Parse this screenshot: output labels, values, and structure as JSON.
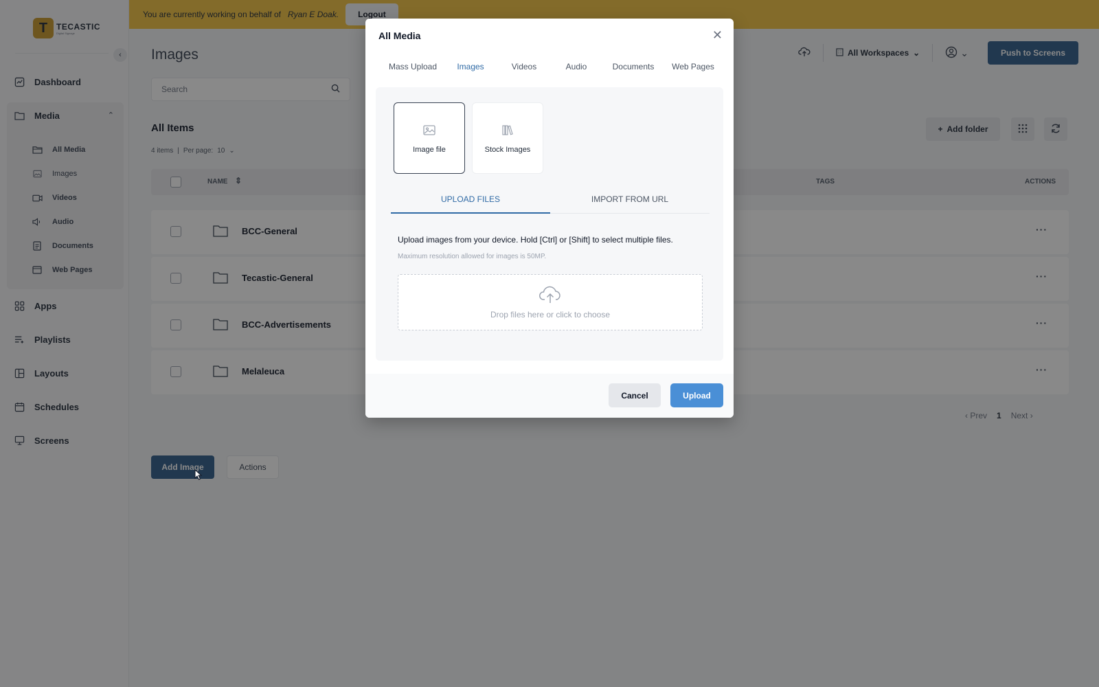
{
  "banner": {
    "prefix": "You are currently working on behalf of",
    "user": "Ryan E Doak.",
    "logout_label": "Logout"
  },
  "brand": {
    "name": "TECASTIC",
    "tagline": "Digital Signage",
    "color": "#c9982a"
  },
  "sidebar": {
    "items": [
      {
        "label": "Dashboard",
        "icon": "dashboard-icon"
      },
      {
        "label": "Media",
        "icon": "folder-icon"
      },
      {
        "label": "Apps",
        "icon": "apps-grid-icon"
      },
      {
        "label": "Playlists",
        "icon": "playlist-icon"
      },
      {
        "label": "Layouts",
        "icon": "layout-icon"
      },
      {
        "label": "Schedules",
        "icon": "calendar-icon"
      },
      {
        "label": "Screens",
        "icon": "monitor-icon"
      }
    ],
    "media_items": [
      {
        "label": "All Media",
        "icon": "folder-open-icon"
      },
      {
        "label": "Images",
        "icon": "image-icon"
      },
      {
        "label": "Videos",
        "icon": "video-icon"
      },
      {
        "label": "Audio",
        "icon": "speaker-icon"
      },
      {
        "label": "Documents",
        "icon": "document-icon"
      },
      {
        "label": "Web Pages",
        "icon": "browser-icon"
      }
    ]
  },
  "header": {
    "title": "Images",
    "search_placeholder": "Search",
    "workspace": "All Workspaces",
    "push_label": "Push to Screens"
  },
  "list": {
    "title": "All Items",
    "count": "4 items",
    "per_page_label": "Per page:",
    "per_page_value": "10",
    "add_folder_label": "Add folder",
    "columns": {
      "name": "NAME",
      "tags": "TAGS",
      "actions": "ACTIONS"
    },
    "rows": [
      {
        "name": "BCC-General"
      },
      {
        "name": "Tecastic-General"
      },
      {
        "name": "BCC-Advertisements"
      },
      {
        "name": "Melaleuca"
      }
    ],
    "actions_glyph": "···"
  },
  "pager": {
    "prev": "Prev",
    "page": "1",
    "next": "Next"
  },
  "footer_actions": {
    "add_image": "Add Image",
    "actions": "Actions"
  },
  "modal": {
    "title": "All Media",
    "tabs": [
      {
        "label": "Mass Upload"
      },
      {
        "label": "Images"
      },
      {
        "label": "Videos"
      },
      {
        "label": "Audio"
      },
      {
        "label": "Documents"
      },
      {
        "label": "Web Pages"
      }
    ],
    "active_tab": "Images",
    "sources": [
      {
        "label": "Image file",
        "icon": "image-icon",
        "selected": true
      },
      {
        "label": "Stock Images",
        "icon": "stock-library-icon",
        "selected": false
      }
    ],
    "subtabs": [
      {
        "label": "UPLOAD FILES"
      },
      {
        "label": "IMPORT FROM URL"
      }
    ],
    "help": "Upload images from your device. Hold [Ctrl] or [Shift] to select multiple files.",
    "help_sub": "Maximum resolution allowed for images is 50MP.",
    "dropzone": "Drop files here or click to choose",
    "cancel_label": "Cancel",
    "upload_label": "Upload"
  },
  "colors": {
    "banner": "#f2c341",
    "primary": "#2f5d8a",
    "accent": "#2f6aa5",
    "upload_button": "#4a8fd6"
  }
}
